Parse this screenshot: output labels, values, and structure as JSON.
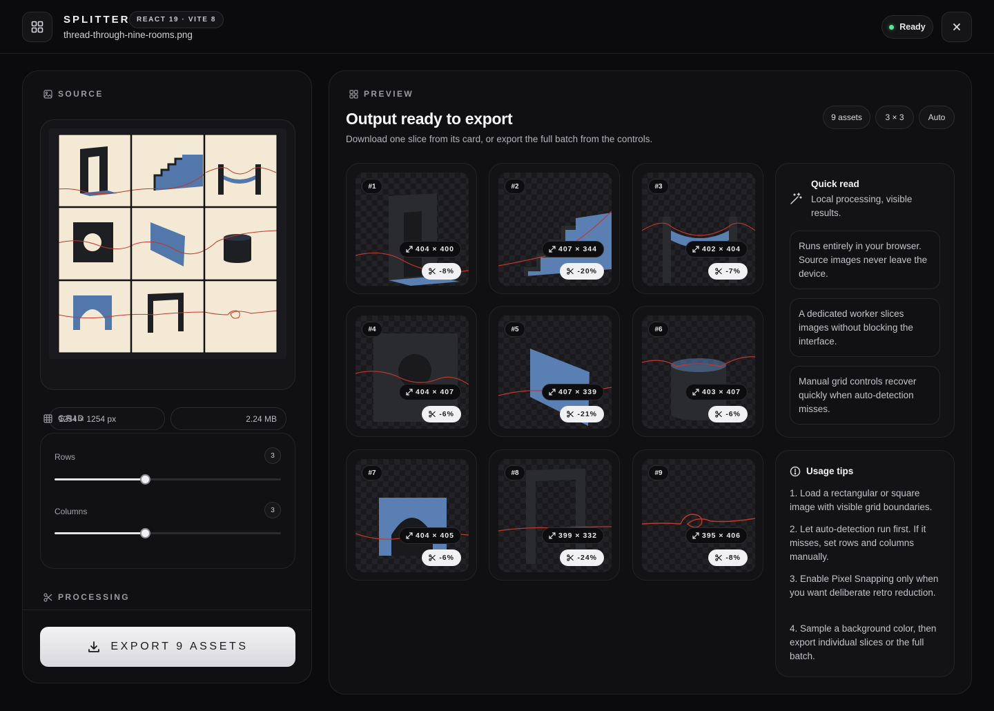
{
  "header": {
    "app_title": "SPLITTER",
    "stack_badge": "REACT 19 · VITE 8",
    "file_name": "thread-through-nine-rooms.png",
    "status": "Ready",
    "status_color": "#5de39a"
  },
  "source": {
    "label": "SOURCE",
    "dimensions": "1254 × 1254 px",
    "file_size": "2.24 MB"
  },
  "grid": {
    "label": "GRID",
    "rows_label": "Rows",
    "rows_value": "3",
    "rows_fraction": 0.4,
    "columns_label": "Columns",
    "columns_value": "3",
    "columns_fraction": 0.4
  },
  "processing": {
    "label": "PROCESSING",
    "export_label": "EXPORT 9 ASSETS"
  },
  "preview": {
    "label": "PREVIEW",
    "title": "Output ready to export",
    "subtitle": "Download one slice from its card, or export the full batch from the controls.",
    "chips": [
      "9 assets",
      "3 × 3",
      "Auto"
    ],
    "tiles": [
      {
        "num": "#1",
        "dims": "404 × 400",
        "cut": "-8%"
      },
      {
        "num": "#2",
        "dims": "407 × 344",
        "cut": "-20%"
      },
      {
        "num": "#3",
        "dims": "402 × 404",
        "cut": "-7%"
      },
      {
        "num": "#4",
        "dims": "404 × 407",
        "cut": "-6%"
      },
      {
        "num": "#5",
        "dims": "407 × 339",
        "cut": "-21%"
      },
      {
        "num": "#6",
        "dims": "403 × 407",
        "cut": "-6%"
      },
      {
        "num": "#7",
        "dims": "404 × 405",
        "cut": "-6%"
      },
      {
        "num": "#8",
        "dims": "399 × 332",
        "cut": "-24%"
      },
      {
        "num": "#9",
        "dims": "395 × 406",
        "cut": "-8%"
      }
    ]
  },
  "quick_read": {
    "title": "Quick read",
    "subtitle": "Local processing, visible results.",
    "items": [
      "Runs entirely in your browser. Source images never leave the device.",
      "A dedicated worker slices images without blocking the interface.",
      "Manual grid controls recover quickly when auto-detection misses."
    ]
  },
  "usage_tips": {
    "title": "Usage tips",
    "items": [
      "1. Load a rectangular or square image with visible grid boundaries.",
      "2. Let auto-detection run first. If it misses, set rows and columns manually.",
      "3. Enable Pixel Snapping only when you want deliberate retro reduction.",
      "4. Sample a background color, then export individual slices or the full batch."
    ]
  }
}
